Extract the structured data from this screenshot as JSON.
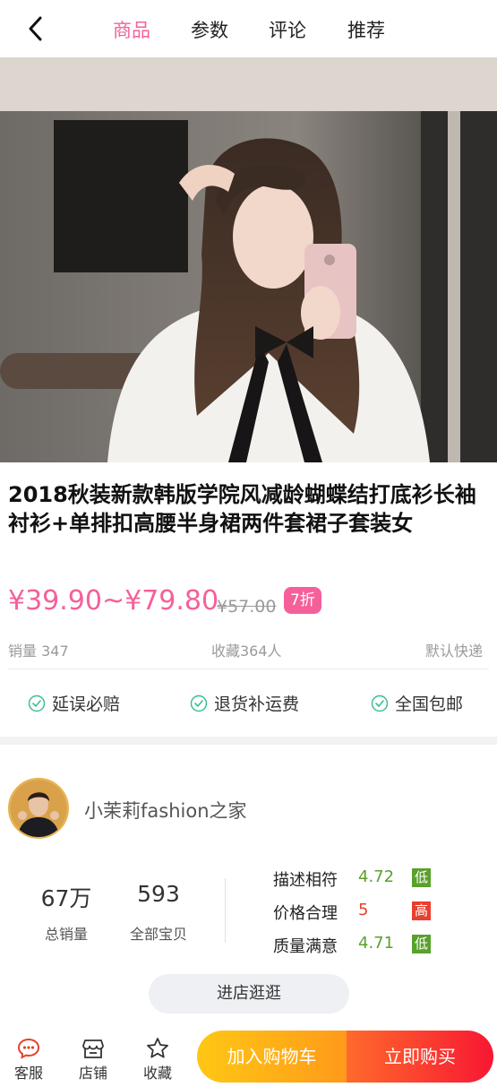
{
  "nav": {
    "tabs": [
      {
        "label": "商品",
        "active": true
      },
      {
        "label": "参数",
        "active": false
      },
      {
        "label": "评论",
        "active": false
      },
      {
        "label": "推荐",
        "active": false
      }
    ]
  },
  "product": {
    "title": "2018秋装新款韩版学院风减龄蝴蝶结打底衫长袖衬衫+单排扣高腰半身裙两件套裙子套装女",
    "price": "¥39.90~¥79.80",
    "original_price": "¥57.00",
    "discount": "7折",
    "sales": "销量 347",
    "favorites": "收藏364人",
    "shipping": "默认快递",
    "guarantees": [
      "延误必赔",
      "退货补运费",
      "全国包邮"
    ]
  },
  "shop": {
    "name": "小茉莉fashion之家",
    "total_sales_value": "67万",
    "total_sales_label": "总销量",
    "items_value": "593",
    "items_label": "全部宝贝",
    "ratings": [
      {
        "label": "描述相符",
        "score": "4.72",
        "level": "低",
        "color": "#5aa02c"
      },
      {
        "label": "价格合理",
        "score": "5",
        "level": "高",
        "color": "#e8402f"
      },
      {
        "label": "质量满意",
        "score": "4.71",
        "level": "低",
        "color": "#5aa02c"
      }
    ],
    "enter_label": "进店逛逛"
  },
  "bottom_bar": {
    "service": "客服",
    "store": "店铺",
    "favorite": "收藏",
    "add_to_cart": "加入购物车",
    "buy_now": "立即购买"
  },
  "colors": {
    "accent": "#f5609b",
    "guarantee_icon": "#3cc08d",
    "service_icon": "#e8402f"
  },
  "icons": {
    "back": "chevron-left-icon",
    "guarantee": "check-circle-icon",
    "service": "chat-bubble-icon",
    "store": "store-icon",
    "favorite": "star-icon"
  }
}
